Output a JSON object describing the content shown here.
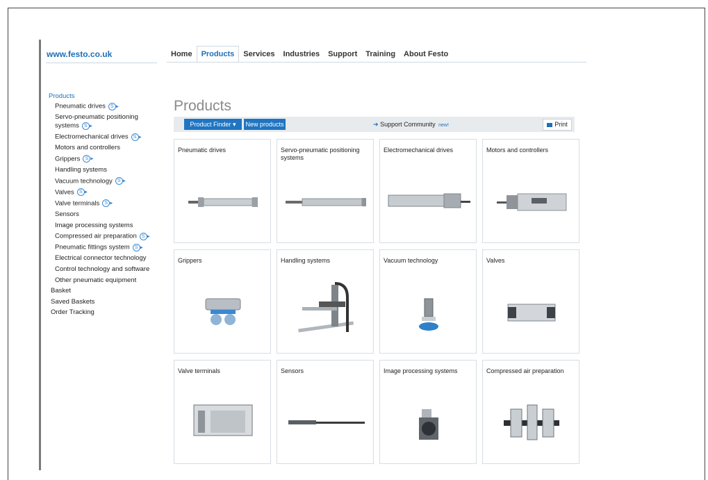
{
  "site": {
    "logo": "www.festo.co.uk",
    "nav": [
      "Home",
      "Products",
      "Services",
      "Industries",
      "Support",
      "Training",
      "About Festo"
    ],
    "active_nav": "Products"
  },
  "sidebar": {
    "header": "Products",
    "items": [
      {
        "label": "Pneumatic drives",
        "ext": true
      },
      {
        "label": "Servo-pneumatic positioning systems",
        "ext": true
      },
      {
        "label": "Electromechanical drives",
        "ext": true
      },
      {
        "label": "Motors and controllers",
        "ext": false
      },
      {
        "label": "Grippers",
        "ext": true
      },
      {
        "label": "Handling systems",
        "ext": false
      },
      {
        "label": "Vacuum technology",
        "ext": true
      },
      {
        "label": "Valves",
        "ext": true
      },
      {
        "label": "Valve terminals",
        "ext": true
      },
      {
        "label": "Sensors",
        "ext": false
      },
      {
        "label": "Image processing systems",
        "ext": false
      },
      {
        "label": "Compressed air preparation",
        "ext": true
      },
      {
        "label": "Pneumatic fittings system",
        "ext": true
      },
      {
        "label": "Electrical connector technology",
        "ext": false
      },
      {
        "label": "Control technology and software",
        "ext": false
      },
      {
        "label": "Other pneumatic equipment",
        "ext": false
      }
    ],
    "extra": [
      "Basket",
      "Saved Baskets",
      "Order Tracking"
    ]
  },
  "main": {
    "title": "Products",
    "toolbar": {
      "finder": "Product Finder",
      "new_products": "New products",
      "support": "Support Community",
      "support_badge": "new!",
      "print": "Print"
    },
    "cards": [
      {
        "label": "Pneumatic drives",
        "icon": "pneumatic-cylinder-icon"
      },
      {
        "label": "Servo-pneumatic positioning systems",
        "icon": "servo-cylinder-icon"
      },
      {
        "label": "Electromechanical drives",
        "icon": "electromechanical-axis-icon"
      },
      {
        "label": "Motors and controllers",
        "icon": "motor-icon"
      },
      {
        "label": "Grippers",
        "icon": "gripper-icon"
      },
      {
        "label": "Handling systems",
        "icon": "handling-system-icon"
      },
      {
        "label": "Vacuum technology",
        "icon": "vacuum-suction-cup-icon"
      },
      {
        "label": "Valves",
        "icon": "valve-icon"
      },
      {
        "label": "Valve terminals",
        "icon": "valve-terminal-icon"
      },
      {
        "label": "Sensors",
        "icon": "sensor-icon"
      },
      {
        "label": "Image processing systems",
        "icon": "camera-icon"
      },
      {
        "label": "Compressed air preparation",
        "icon": "air-preparation-icon"
      }
    ]
  },
  "colors": {
    "brand_blue": "#1d6fb8",
    "button_blue": "#1f75c2"
  }
}
